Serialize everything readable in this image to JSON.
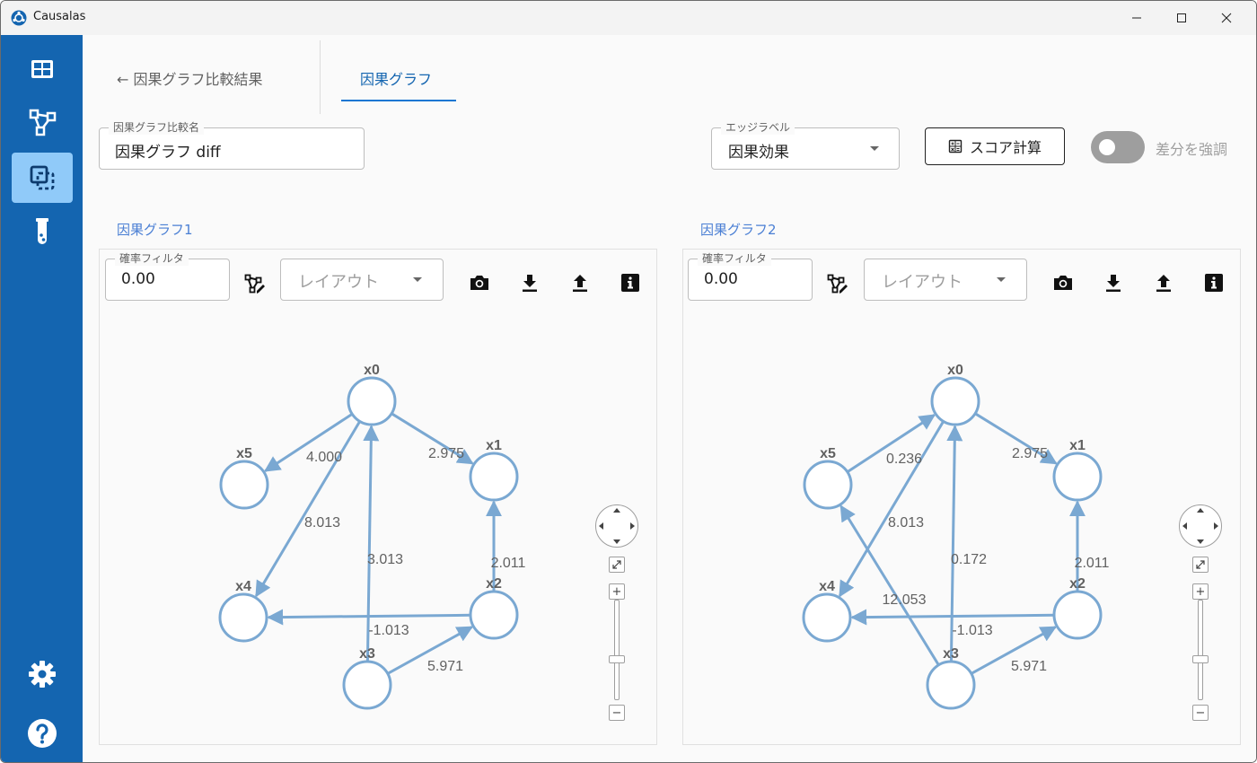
{
  "window": {
    "title": "Causalas"
  },
  "tabs": {
    "back": "← 因果グラフ比較結果",
    "active": "因果グラフ"
  },
  "comparison_name": {
    "label": "因果グラフ比較名",
    "value": "因果グラフ diff"
  },
  "edge_label": {
    "label": "エッジラベル",
    "value": "因果効果"
  },
  "score_button": "スコア計算",
  "highlight_diff": {
    "label": "差分を強調",
    "on": false
  },
  "colors": {
    "sidebar": "#1465b0",
    "accent": "#1976d2",
    "node": "#7aa8d2",
    "edge": "#7aa8d2"
  },
  "graphs": [
    {
      "title": "因果グラフ1",
      "prob_filter": {
        "label": "確率フィルタ",
        "value": "0.00"
      },
      "layout_placeholder": "レイアウト",
      "nodes": [
        {
          "id": "x0",
          "label": "x0"
        },
        {
          "id": "x1",
          "label": "x1"
        },
        {
          "id": "x2",
          "label": "x2"
        },
        {
          "id": "x3",
          "label": "x3"
        },
        {
          "id": "x4",
          "label": "x4"
        },
        {
          "id": "x5",
          "label": "x5"
        }
      ],
      "edges": [
        {
          "from": "x0",
          "to": "x5",
          "label": "4.000"
        },
        {
          "from": "x0",
          "to": "x1",
          "label": "2.975"
        },
        {
          "from": "x0",
          "to": "x4",
          "label": "8.013"
        },
        {
          "from": "x3",
          "to": "x0",
          "label": "3.013"
        },
        {
          "from": "x2",
          "to": "x1",
          "label": "2.011"
        },
        {
          "from": "x2",
          "to": "x4",
          "label": "-1.013"
        },
        {
          "from": "x3",
          "to": "x2",
          "label": "5.971"
        }
      ]
    },
    {
      "title": "因果グラフ2",
      "prob_filter": {
        "label": "確率フィルタ",
        "value": "0.00"
      },
      "layout_placeholder": "レイアウト",
      "nodes": [
        {
          "id": "x0",
          "label": "x0"
        },
        {
          "id": "x1",
          "label": "x1"
        },
        {
          "id": "x2",
          "label": "x2"
        },
        {
          "id": "x3",
          "label": "x3"
        },
        {
          "id": "x4",
          "label": "x4"
        },
        {
          "id": "x5",
          "label": "x5"
        }
      ],
      "edges": [
        {
          "from": "x5",
          "to": "x0",
          "label": "0.236"
        },
        {
          "from": "x0",
          "to": "x1",
          "label": "2.975"
        },
        {
          "from": "x0",
          "to": "x4",
          "label": "8.013"
        },
        {
          "from": "x3",
          "to": "x0",
          "label": "0.172"
        },
        {
          "from": "x2",
          "to": "x1",
          "label": "2.011"
        },
        {
          "from": "x3",
          "to": "x5",
          "label": "12.053"
        },
        {
          "from": "x2",
          "to": "x4",
          "label": "-1.013"
        },
        {
          "from": "x3",
          "to": "x2",
          "label": "5.971"
        }
      ]
    }
  ],
  "zoom_controls": {
    "zoom_in": "+",
    "zoom_out": "−"
  }
}
